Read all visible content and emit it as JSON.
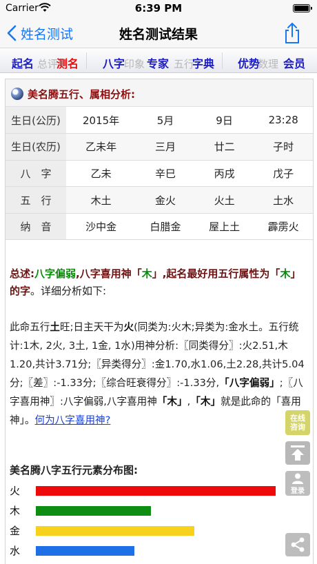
{
  "status_bar": {
    "carrier": "Carrier",
    "time": "6:39 PM"
  },
  "nav": {
    "back_label": "姓名测试",
    "title": "姓名测试结果"
  },
  "menu": {
    "items": [
      "起名",
      "测名",
      "八字",
      "专家",
      "字典",
      "优势",
      "会员"
    ],
    "active": "测名",
    "ghost_items": [
      "总评",
      "印象",
      "五行",
      "数理"
    ]
  },
  "analysis": {
    "title": "美名腾五行、属相分析:",
    "rows": [
      {
        "head": "生日(公历)",
        "cells": [
          "2015年",
          "5月",
          "9日",
          "23:28"
        ]
      },
      {
        "head": "生日(农历)",
        "cells": [
          "乙未年",
          "三月",
          "廿二",
          "子时"
        ]
      },
      {
        "head": "八　字",
        "cells": [
          "乙未",
          "辛巳",
          "丙戌",
          "戊子"
        ]
      },
      {
        "head": "五　行",
        "cells": [
          "木土",
          "金火",
          "火土",
          "土水"
        ]
      },
      {
        "head": "纳　音",
        "cells": [
          "沙中金",
          "白腊金",
          "屋上土",
          "霹雳火"
        ]
      }
    ]
  },
  "summary": {
    "prefix": "总述:",
    "weak": "八字偏弱",
    "mid1": ",八字喜用神「",
    "element": "木",
    "mid2": "」,起名最好用五行属性为「",
    "element2": "木",
    "suffix": "」的字",
    "tail": "。详细分析如下:"
  },
  "detail": {
    "p1a": "此命五行",
    "p1b": "土",
    "p1c": "旺;日主天干为",
    "p1d": "火",
    "p1e": "(同类为:火木;异类为:金水土。五行统计:1木, 2火, 3土, 1金, 1水)用神分析:〖同类得分〗:火2.51,木1.20,共计3.71分;〖异类得分〗:金1.70,水1.06,土2.28,共计5.04分;〖差〗:-1.33分;〖综合旺衰得分〗:-1.33分,",
    "q1": "「八字偏弱」",
    "p1f": ";〖八字喜用神〗:八字偏弱,八字喜用神",
    "q2": "「木」",
    "p1g": ",",
    "q3": "「木」",
    "p1h": "就是此命的「喜用神」。",
    "link": "何为八字喜用神?"
  },
  "distribution": {
    "title": "美名腾八字五行元素分布图:",
    "bars": [
      {
        "label": "火",
        "fraction": 1.0,
        "color": "#ee0a0a"
      },
      {
        "label": "木",
        "fraction": 0.48,
        "color": "#0d8d12"
      },
      {
        "label": "金",
        "fraction": 0.66,
        "color": "#f6d21c"
      },
      {
        "label": "水",
        "fraction": 0.41,
        "color": "#1f6fe6"
      }
    ]
  },
  "side_buttons": {
    "online": "在线咨询",
    "login": "登录"
  },
  "colors": {
    "accent": "#1976f2",
    "menu_text": "#1c1cc4",
    "menu_active": "#e01010",
    "title_red": "#8a1010"
  }
}
